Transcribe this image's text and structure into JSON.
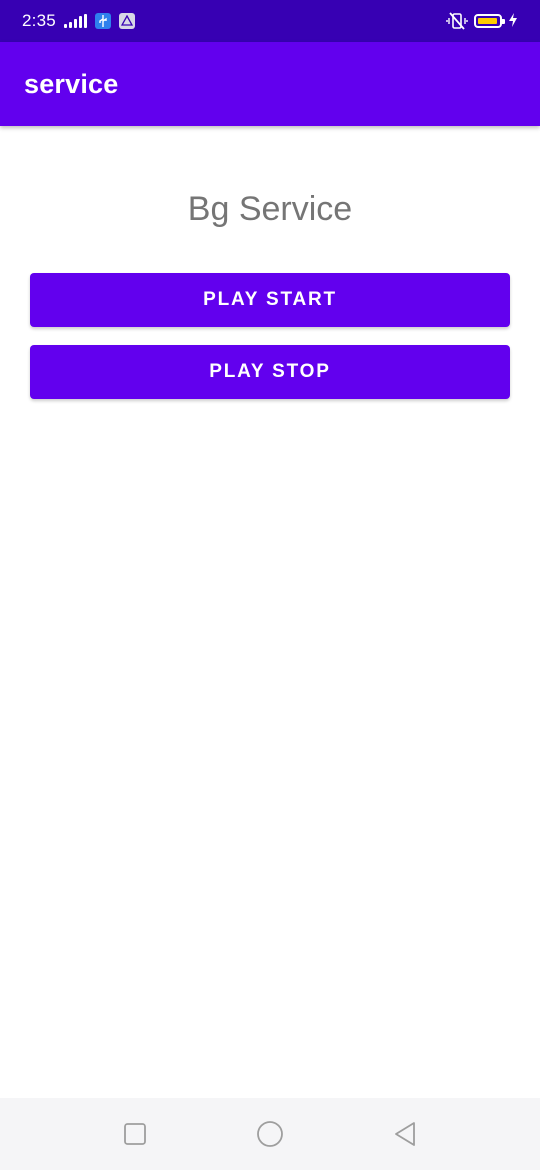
{
  "status_bar": {
    "time": "2:35",
    "icons": [
      "signal-icon",
      "usb-icon",
      "notification-icon",
      "vibrate-off-icon",
      "battery-icon",
      "charging-icon"
    ],
    "battery_color": "#ffcc00"
  },
  "app_bar": {
    "title": "service",
    "color": "#6200ee"
  },
  "main": {
    "heading": "Bg Service",
    "buttons": [
      {
        "label": "PLAY START"
      },
      {
        "label": "PLAY STOP"
      }
    ],
    "button_color": "#6200ee"
  },
  "nav_bar": {
    "icons": [
      "recents-icon",
      "home-icon",
      "back-icon"
    ]
  }
}
